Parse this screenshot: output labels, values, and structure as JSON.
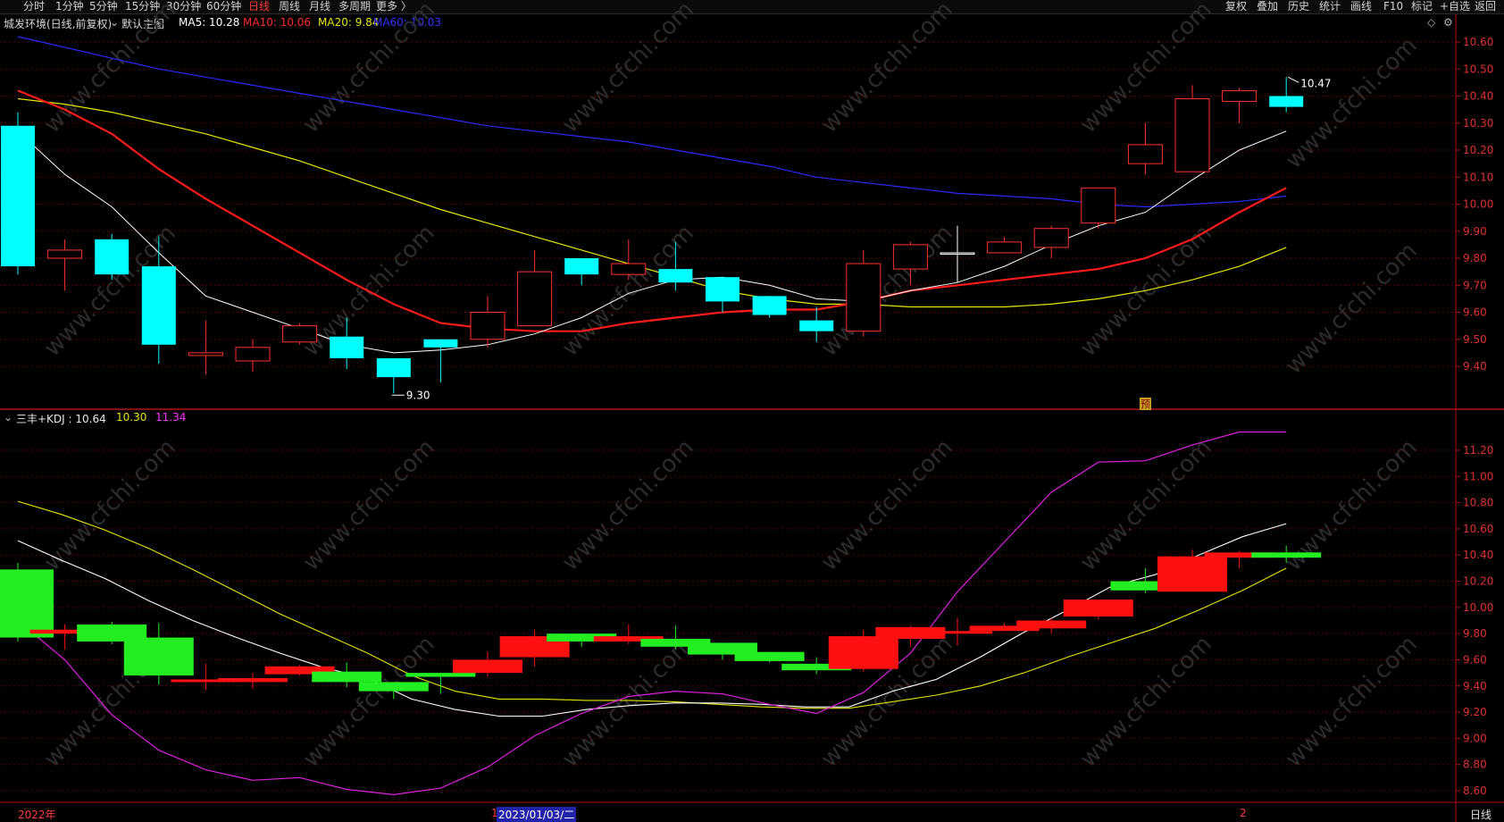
{
  "toolbar": {
    "left": [
      "分时",
      "1分钟",
      "5分钟",
      "15分钟",
      "30分钟",
      "60分钟",
      "日线",
      "周线",
      "月线",
      "多周期",
      "更多 〉"
    ],
    "active": "日线",
    "right": [
      "复权",
      "叠加",
      "历史",
      "统计",
      "画线",
      "F10",
      "标记",
      "+自选",
      "返回"
    ]
  },
  "main_header": {
    "title": "城发环境(日线,前复权)",
    "template": "默认主图",
    "ma": [
      {
        "label": "MA5: 10.28",
        "color": "#ffffff"
      },
      {
        "label": "MA10: 10.06",
        "color": "#ff2a2a"
      },
      {
        "label": "MA20: 9.84",
        "color": "#e6e600"
      },
      {
        "label": "MA60: 10.03",
        "color": "#3333ff"
      }
    ]
  },
  "sub_header": {
    "title": "三丰+KDJ : 10.64",
    "values": [
      {
        "label": "10.30",
        "color": "#e6e600"
      },
      {
        "label": "11.34",
        "color": "#ff33ff"
      }
    ]
  },
  "bottom": {
    "date_left": "2022年",
    "date_mid": "2023/01/03/二",
    "marker_left": "1",
    "marker_right": "2",
    "period": "日线"
  },
  "watermark": "www.cfchi.com",
  "chart_data": [
    {
      "type": "candlestick",
      "title": "城发环境(日线,前复权)",
      "ylim": [
        9.3,
        10.65
      ],
      "y_ticks": [
        9.4,
        9.5,
        9.6,
        9.7,
        9.8,
        9.9,
        10.0,
        10.1,
        10.2,
        10.3,
        10.4,
        10.5,
        10.6
      ],
      "candles": [
        {
          "o": 10.29,
          "h": 10.34,
          "l": 9.74,
          "c": 9.77
        },
        {
          "o": 9.8,
          "h": 9.87,
          "l": 9.68,
          "c": 9.83
        },
        {
          "o": 9.87,
          "h": 9.89,
          "l": 9.72,
          "c": 9.74
        },
        {
          "o": 9.77,
          "h": 9.88,
          "l": 9.41,
          "c": 9.48
        },
        {
          "o": 9.44,
          "h": 9.57,
          "l": 9.37,
          "c": 9.45
        },
        {
          "o": 9.42,
          "h": 9.5,
          "l": 9.38,
          "c": 9.47
        },
        {
          "o": 9.49,
          "h": 9.56,
          "l": 9.48,
          "c": 9.55
        },
        {
          "o": 9.51,
          "h": 9.58,
          "l": 9.39,
          "c": 9.43
        },
        {
          "o": 9.43,
          "h": 9.43,
          "l": 9.3,
          "c": 9.36
        },
        {
          "o": 9.5,
          "h": 9.5,
          "l": 9.34,
          "c": 9.47
        },
        {
          "o": 9.5,
          "h": 9.66,
          "l": 9.47,
          "c": 9.6
        },
        {
          "o": 9.55,
          "h": 9.83,
          "l": 9.55,
          "c": 9.75
        },
        {
          "o": 9.8,
          "h": 9.8,
          "l": 9.7,
          "c": 9.74
        },
        {
          "o": 9.74,
          "h": 9.87,
          "l": 9.72,
          "c": 9.78
        },
        {
          "o": 9.76,
          "h": 9.86,
          "l": 9.68,
          "c": 9.71
        },
        {
          "o": 9.73,
          "h": 9.73,
          "l": 9.6,
          "c": 9.64
        },
        {
          "o": 9.66,
          "h": 9.66,
          "l": 9.58,
          "c": 9.59
        },
        {
          "o": 9.57,
          "h": 9.62,
          "l": 9.49,
          "c": 9.53
        },
        {
          "o": 9.53,
          "h": 9.83,
          "l": 9.51,
          "c": 9.78
        },
        {
          "o": 9.76,
          "h": 9.86,
          "l": 9.7,
          "c": 9.85
        },
        {
          "o": 9.82,
          "h": 9.92,
          "l": 9.71,
          "c": 9.82
        },
        {
          "o": 9.82,
          "h": 9.88,
          "l": 9.82,
          "c": 9.86
        },
        {
          "o": 9.84,
          "h": 9.92,
          "l": 9.8,
          "c": 9.91
        },
        {
          "o": 9.93,
          "h": 10.06,
          "l": 9.91,
          "c": 10.06
        },
        {
          "o": 10.15,
          "h": 10.3,
          "l": 10.11,
          "c": 10.22
        },
        {
          "o": 10.12,
          "h": 10.44,
          "l": 10.12,
          "c": 10.39
        },
        {
          "o": 10.38,
          "h": 10.43,
          "l": 10.3,
          "c": 10.42
        },
        {
          "o": 10.4,
          "h": 10.47,
          "l": 10.34,
          "c": 10.36
        }
      ],
      "ma5": [
        10.27,
        10.11,
        9.99,
        9.82,
        9.66,
        9.6,
        9.54,
        9.48,
        9.45,
        9.46,
        9.48,
        9.52,
        9.58,
        9.67,
        9.72,
        9.73,
        9.7,
        9.65,
        9.64,
        9.68,
        9.71,
        9.77,
        9.85,
        9.92,
        9.97,
        10.09,
        10.2,
        10.27
      ],
      "ma10": [
        10.42,
        10.35,
        10.26,
        10.13,
        10.02,
        9.92,
        9.82,
        9.72,
        9.63,
        9.56,
        9.54,
        9.53,
        9.53,
        9.56,
        9.58,
        9.6,
        9.61,
        9.61,
        9.64,
        9.68,
        9.7,
        9.72,
        9.74,
        9.76,
        9.8,
        9.87,
        9.97,
        10.06
      ],
      "ma20": [
        10.39,
        10.37,
        10.34,
        10.3,
        10.26,
        10.21,
        10.16,
        10.1,
        10.04,
        9.98,
        9.93,
        9.88,
        9.83,
        9.78,
        9.73,
        9.68,
        9.65,
        9.63,
        9.63,
        9.62,
        9.62,
        9.62,
        9.63,
        9.65,
        9.68,
        9.72,
        9.77,
        9.84
      ],
      "ma60": [
        10.62,
        10.58,
        10.54,
        10.5,
        10.47,
        10.44,
        10.41,
        10.38,
        10.35,
        10.32,
        10.29,
        10.27,
        10.25,
        10.23,
        10.2,
        10.17,
        10.14,
        10.1,
        10.08,
        10.06,
        10.04,
        10.03,
        10.02,
        10.0,
        9.99,
        10.0,
        10.01,
        10.03
      ],
      "annotations": [
        {
          "label": "10.47",
          "candle": 27,
          "value": 10.47
        },
        {
          "label": "9.30",
          "candle": 8,
          "value": 9.3
        }
      ],
      "flag_label": "预"
    },
    {
      "type": "indicator",
      "title": "三丰+KDJ",
      "ylim": [
        8.55,
        11.35
      ],
      "y_ticks": [
        8.6,
        8.8,
        9.0,
        9.2,
        9.4,
        9.6,
        9.8,
        10.0,
        10.2,
        10.4,
        10.6,
        10.8,
        11.0,
        11.2
      ],
      "blocks": [
        {
          "o": 10.29,
          "c": 9.77,
          "h": 10.34,
          "l": 9.74
        },
        {
          "o": 9.8,
          "c": 9.83,
          "h": 9.87,
          "l": 9.68
        },
        {
          "o": 9.87,
          "c": 9.74,
          "h": 9.89,
          "l": 9.72
        },
        {
          "o": 9.77,
          "c": 9.48,
          "h": 9.88,
          "l": 9.41
        },
        {
          "o": 9.44,
          "c": 9.45,
          "h": 9.57,
          "l": 9.37
        },
        {
          "o": 9.43,
          "c": 9.46,
          "h": 9.5,
          "l": 9.38
        },
        {
          "o": 9.49,
          "c": 9.55,
          "h": 9.56,
          "l": 9.48
        },
        {
          "o": 9.51,
          "c": 9.43,
          "h": 9.58,
          "l": 9.39
        },
        {
          "o": 9.43,
          "c": 9.36,
          "h": 9.43,
          "l": 9.3
        },
        {
          "o": 9.5,
          "c": 9.47,
          "h": 9.5,
          "l": 9.34
        },
        {
          "o": 9.5,
          "c": 9.6,
          "h": 9.66,
          "l": 9.47
        },
        {
          "o": 9.62,
          "c": 9.78,
          "h": 9.83,
          "l": 9.55
        },
        {
          "o": 9.8,
          "c": 9.74,
          "h": 9.8,
          "l": 9.7
        },
        {
          "o": 9.74,
          "c": 9.78,
          "h": 9.87,
          "l": 9.72
        },
        {
          "o": 9.76,
          "c": 9.7,
          "h": 9.86,
          "l": 9.68
        },
        {
          "o": 9.73,
          "c": 9.64,
          "h": 9.73,
          "l": 9.6
        },
        {
          "o": 9.66,
          "c": 9.59,
          "h": 9.66,
          "l": 9.58
        },
        {
          "o": 9.57,
          "c": 9.52,
          "h": 9.62,
          "l": 9.49
        },
        {
          "o": 9.53,
          "c": 9.78,
          "h": 9.83,
          "l": 9.51
        },
        {
          "o": 9.76,
          "c": 9.85,
          "h": 9.86,
          "l": 9.7
        },
        {
          "o": 9.82,
          "c": 9.82,
          "h": 9.92,
          "l": 9.71
        },
        {
          "o": 9.82,
          "c": 9.86,
          "h": 9.88,
          "l": 9.82
        },
        {
          "o": 9.84,
          "c": 9.9,
          "h": 9.92,
          "l": 9.8
        },
        {
          "o": 9.93,
          "c": 10.06,
          "h": 10.06,
          "l": 9.91
        },
        {
          "o": 10.2,
          "c": 10.13,
          "h": 10.3,
          "l": 10.11
        },
        {
          "o": 10.12,
          "c": 10.39,
          "h": 10.44,
          "l": 10.12
        },
        {
          "o": 10.38,
          "c": 10.42,
          "h": 10.43,
          "l": 10.3
        },
        {
          "o": 10.42,
          "c": 10.38,
          "h": 10.47,
          "l": 10.34
        }
      ],
      "k": [
        10.51,
        10.36,
        10.22,
        10.05,
        9.9,
        9.77,
        9.65,
        9.54,
        9.46,
        9.3,
        9.22,
        9.17,
        9.17,
        9.22,
        9.25,
        9.27,
        9.27,
        9.26,
        9.24,
        9.24,
        9.36,
        9.45,
        9.62,
        9.81,
        9.98,
        10.16,
        10.25,
        10.4,
        10.54,
        10.64
      ],
      "d": [
        10.81,
        10.71,
        10.59,
        10.45,
        10.29,
        10.12,
        9.95,
        9.8,
        9.65,
        9.48,
        9.36,
        9.3,
        9.3,
        9.29,
        9.29,
        9.28,
        9.26,
        9.24,
        9.23,
        9.23,
        9.28,
        9.33,
        9.4,
        9.5,
        9.62,
        9.73,
        9.84,
        9.98,
        10.13,
        10.3
      ],
      "j": [
        9.9,
        9.6,
        9.18,
        8.91,
        8.76,
        8.68,
        8.7,
        8.61,
        8.57,
        8.62,
        8.78,
        9.02,
        9.19,
        9.32,
        9.36,
        9.34,
        9.26,
        9.19,
        9.35,
        9.65,
        10.12,
        10.5,
        10.88,
        11.11,
        11.12,
        11.24,
        11.34,
        11.34
      ]
    }
  ]
}
